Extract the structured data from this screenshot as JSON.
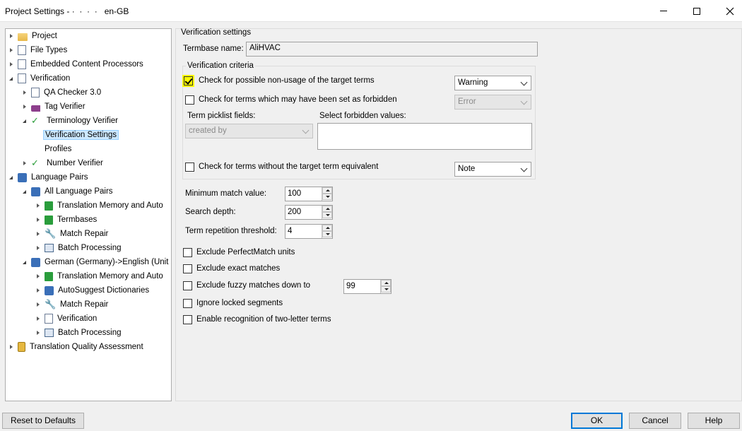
{
  "window": {
    "title": "Project Settings - ·  ·  ·  ·   en-GB"
  },
  "tree": [
    {
      "label": "Project",
      "icon": "project-folder-icon",
      "level": 0,
      "expander": "closed",
      "selected": false
    },
    {
      "label": "File Types",
      "icon": "file-types-icon",
      "level": 0,
      "expander": "closed",
      "selected": false
    },
    {
      "label": "Embedded Content Processors",
      "icon": "embedded-content-icon",
      "level": 0,
      "expander": "closed",
      "selected": false
    },
    {
      "label": "Verification",
      "icon": "verification-icon",
      "level": 0,
      "expander": "open",
      "selected": false
    },
    {
      "label": "QA Checker 3.0",
      "icon": "qa-checker-icon",
      "level": 1,
      "expander": "closed",
      "selected": false
    },
    {
      "label": "Tag Verifier",
      "icon": "tag-verifier-icon",
      "level": 1,
      "expander": "closed",
      "selected": false
    },
    {
      "label": "Terminology Verifier",
      "icon": "terminology-verifier-icon",
      "level": 1,
      "expander": "open",
      "selected": false
    },
    {
      "label": "Verification Settings",
      "icon": "",
      "level": 2,
      "expander": "none",
      "selected": true
    },
    {
      "label": "Profiles",
      "icon": "",
      "level": 2,
      "expander": "none",
      "selected": false
    },
    {
      "label": "Number Verifier",
      "icon": "number-verifier-icon",
      "level": 1,
      "expander": "closed",
      "selected": false
    },
    {
      "label": "Language Pairs",
      "icon": "language-pairs-icon",
      "level": 0,
      "expander": "open",
      "selected": false
    },
    {
      "label": "All Language Pairs",
      "icon": "language-pairs-icon",
      "level": 1,
      "expander": "open",
      "selected": false
    },
    {
      "label": "Translation Memory and Auto",
      "icon": "translation-memory-icon",
      "level": 2,
      "expander": "closed",
      "selected": false
    },
    {
      "label": "Termbases",
      "icon": "termbases-icon",
      "level": 2,
      "expander": "closed",
      "selected": false
    },
    {
      "label": "Match Repair",
      "icon": "wrench-icon",
      "level": 2,
      "expander": "closed",
      "selected": false
    },
    {
      "label": "Batch Processing",
      "icon": "batch-processing-icon",
      "level": 2,
      "expander": "closed",
      "selected": false
    },
    {
      "label": "German (Germany)->English (Unit",
      "icon": "language-pairs-icon",
      "level": 1,
      "expander": "open",
      "selected": false
    },
    {
      "label": "Translation Memory and Auto",
      "icon": "translation-memory-icon",
      "level": 2,
      "expander": "closed",
      "selected": false
    },
    {
      "label": "AutoSuggest Dictionaries",
      "icon": "autosuggest-icon",
      "level": 2,
      "expander": "closed",
      "selected": false
    },
    {
      "label": "Match Repair",
      "icon": "wrench-icon",
      "level": 2,
      "expander": "closed",
      "selected": false
    },
    {
      "label": "Verification",
      "icon": "verification-icon",
      "level": 2,
      "expander": "closed",
      "selected": false
    },
    {
      "label": "Batch Processing",
      "icon": "batch-processing-icon",
      "level": 2,
      "expander": "closed",
      "selected": false
    },
    {
      "label": "Translation Quality Assessment",
      "icon": "quality-assessment-icon",
      "level": 0,
      "expander": "closed",
      "selected": false
    }
  ],
  "main": {
    "section_title": "Verification settings",
    "termbase_label": "Termbase name:",
    "termbase_value": "AliHVAC",
    "criteria_title": "Verification criteria",
    "check_non_usage": {
      "label": "Check for possible non-usage of the target terms",
      "checked": true,
      "severity": "Warning"
    },
    "check_forbidden": {
      "label": "Check for terms which may have been set as forbidden",
      "checked": false,
      "severity": "Error"
    },
    "picklist_label": "Term picklist fields:",
    "picklist_value": "created by",
    "forbidden_values_label": "Select forbidden values:",
    "check_no_equivalent": {
      "label": "Check for terms without the target term equivalent",
      "checked": false,
      "severity": "Note"
    },
    "min_match_label": "Minimum match value:",
    "min_match_value": "100",
    "search_depth_label": "Search depth:",
    "search_depth_value": "200",
    "repetition_label": "Term repetition threshold:",
    "repetition_value": "4",
    "exclude_perfect": {
      "label": "Exclude PerfectMatch units",
      "checked": false
    },
    "exclude_exact": {
      "label": "Exclude exact matches",
      "checked": false
    },
    "exclude_fuzzy": {
      "label": "Exclude fuzzy matches down to",
      "checked": false,
      "value": "99"
    },
    "ignore_locked": {
      "label": "Ignore locked segments",
      "checked": false
    },
    "two_letter": {
      "label": "Enable recognition of two-letter terms",
      "checked": false
    }
  },
  "buttons": {
    "reset": "Reset to Defaults",
    "ok": "OK",
    "cancel": "Cancel",
    "help": "Help"
  },
  "colors": {
    "highlight": "#ffff00",
    "selection": "#cce8ff",
    "primary_border": "#0078d7"
  }
}
